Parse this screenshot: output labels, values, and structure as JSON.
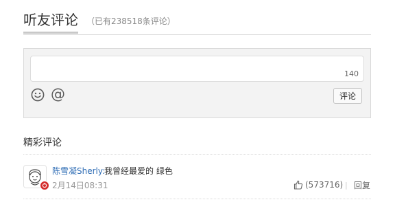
{
  "header": {
    "title": "听友评论",
    "count_text": "（已有238518条评论）"
  },
  "composer": {
    "char_count": "140",
    "emoji_icon": "smiley-icon",
    "mention_symbol": "@",
    "submit_label": "评论"
  },
  "hot_comments": {
    "title": "精彩评论",
    "items": [
      {
        "username": "陈雪凝Sherly:",
        "text": "我曾经最爱的 绿色",
        "time": "2月14日08:31",
        "likes": "(573716)",
        "separator": "|",
        "reply_label": "回复",
        "verified_badge": "vip-badge-icon"
      }
    ]
  },
  "colors": {
    "username": "#2f6db5",
    "badge": "#d42b2b",
    "composer_bg": "#f3f3f3"
  }
}
